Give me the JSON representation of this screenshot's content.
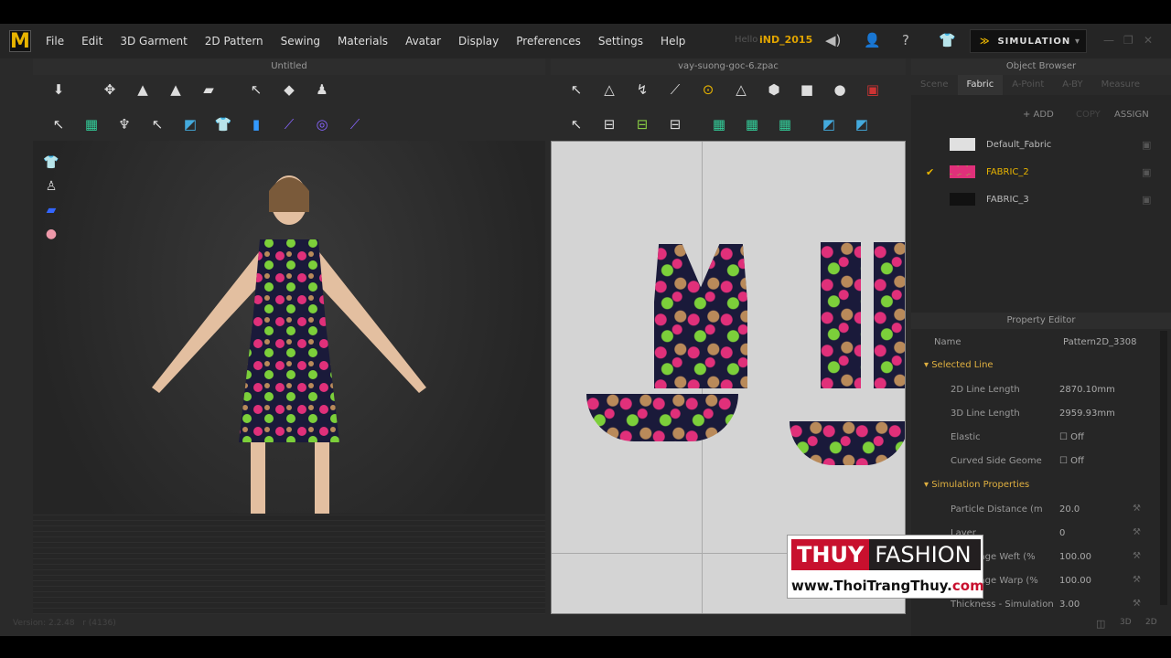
{
  "menubar": {
    "items": [
      "File",
      "Edit",
      "3D Garment",
      "2D Pattern",
      "Sewing",
      "Materials",
      "Avatar",
      "Display",
      "Preferences",
      "Settings",
      "Help"
    ],
    "hello": "Hello",
    "user": "iND_2015",
    "simulation": "SIMULATION"
  },
  "view3d": {
    "title": "Untitled"
  },
  "view2d": {
    "title": "vay-suong-goc-6.zpac"
  },
  "object_browser": {
    "title": "Object Browser",
    "tabs": [
      "Scene",
      "Fabric",
      "A-Point",
      "A-BY",
      "Measure"
    ],
    "active_tab": "Fabric",
    "add": "+ ADD",
    "copy": "COPY",
    "assign": "ASSIGN",
    "fabrics": [
      {
        "name": "Default_Fabric",
        "color": "#e0e0e0",
        "selected": false
      },
      {
        "name": "FABRIC_2",
        "color": "#8a5a50",
        "selected": true
      },
      {
        "name": "FABRIC_3",
        "color": "#111111",
        "selected": false
      }
    ]
  },
  "property_editor": {
    "title": "Property Editor",
    "name_label": "Name",
    "name_value": "Pattern2D_3308",
    "section1": "Selected Line",
    "rows1": [
      {
        "k": "2D Line Length",
        "v": "2870.10mm"
      },
      {
        "k": "3D Line Length",
        "v": "2959.93mm"
      },
      {
        "k": "Elastic",
        "v": "Off"
      },
      {
        "k": "Curved Side Geome",
        "v": "Off"
      }
    ],
    "section2": "Simulation Properties",
    "rows2": [
      {
        "k": "Particle Distance (m",
        "v": "20.0"
      },
      {
        "k": "Layer",
        "v": "0"
      },
      {
        "k": "Shrinkage Weft (%",
        "v": "100.00"
      },
      {
        "k": "Shrinkage Warp (%",
        "v": "100.00"
      },
      {
        "k": "Thickness - Simulation",
        "v": "3.00"
      }
    ]
  },
  "watermark": {
    "brand_a": "THUY",
    "brand_b": "FASHION",
    "url_a": "www.ThoiTrangThuy.",
    "url_b": "com"
  },
  "status": {
    "version": "Version: 2.2.48",
    "build": "r (4136)"
  }
}
